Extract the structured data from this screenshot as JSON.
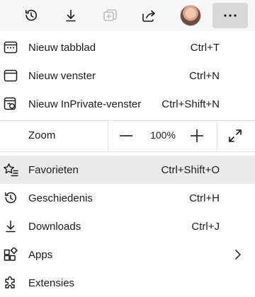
{
  "toolbar": {
    "buttons": [
      {
        "icon": "history-icon"
      },
      {
        "icon": "download-icon"
      },
      {
        "icon": "collections-icon",
        "disabled": true
      },
      {
        "icon": "share-icon"
      },
      {
        "icon": "profile-avatar"
      },
      {
        "icon": "more-icon"
      }
    ]
  },
  "menu": {
    "new_tab": {
      "label": "Nieuw tabblad",
      "shortcut": "Ctrl+T",
      "icon": "new-tab-icon"
    },
    "new_window": {
      "label": "Nieuw venster",
      "shortcut": "Ctrl+N",
      "icon": "new-window-icon"
    },
    "new_inprivate": {
      "label": "Nieuw InPrivate-venster",
      "shortcut": "Ctrl+Shift+N",
      "icon": "inprivate-icon"
    },
    "zoom": {
      "label": "Zoom",
      "value": "100%",
      "minus_icon": "minus-icon",
      "plus_icon": "plus-icon",
      "fullscreen_icon": "fullscreen-icon"
    },
    "favorites": {
      "label": "Favorieten",
      "shortcut": "Ctrl+Shift+O",
      "icon": "favorites-icon",
      "highlighted": true
    },
    "history": {
      "label": "Geschiedenis",
      "shortcut": "Ctrl+H",
      "icon": "history-icon"
    },
    "downloads": {
      "label": "Downloads",
      "shortcut": "Ctrl+J",
      "icon": "download-icon"
    },
    "apps": {
      "label": "Apps",
      "icon": "apps-icon",
      "submenu_icon": "chevron-right-icon"
    },
    "extensions": {
      "label": "Extensies",
      "icon": "extensions-icon"
    }
  },
  "colors": {
    "toolbar_bg": "#f7f7f7",
    "more_button_active": "#d9d9d9",
    "hover_row": "#ebebeb",
    "divider": "#e2e2e2",
    "text": "#1b1b1b",
    "disabled_icon": "#bdbdbd"
  }
}
